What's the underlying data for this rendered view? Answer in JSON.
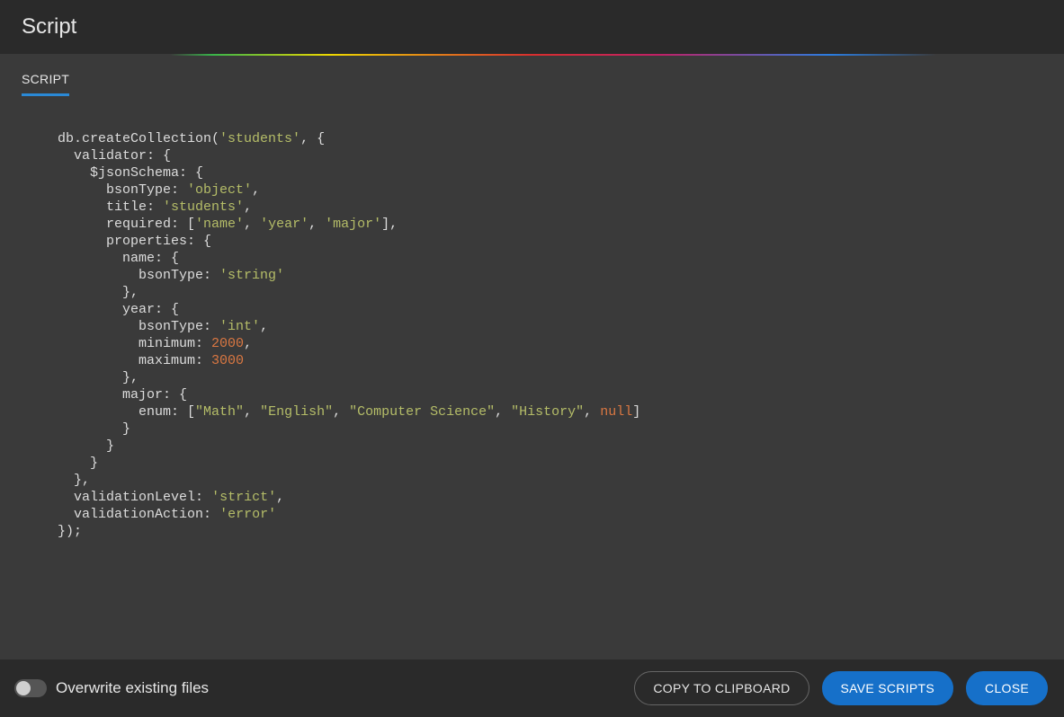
{
  "header": {
    "title": "Script"
  },
  "tabs": {
    "active": "SCRIPT"
  },
  "script": {
    "createCollection_fn": "db.createCollection",
    "collection_name": "'students'",
    "validator_key": "validator",
    "jsonSchema_key": "$jsonSchema",
    "bsonType_key": "bsonType",
    "bsonType_object": "'object'",
    "title_key": "title",
    "title_val": "'students'",
    "required_key": "required",
    "required_items": [
      "'name'",
      "'year'",
      "'major'"
    ],
    "properties_key": "properties",
    "prop_name_key": "name",
    "name_bsonType": "'string'",
    "prop_year_key": "year",
    "year_bsonType": "'int'",
    "minimum_key": "minimum",
    "minimum_val": "2000",
    "maximum_key": "maximum",
    "maximum_val": "3000",
    "prop_major_key": "major",
    "enum_key": "enum",
    "enum_items": [
      "\"Math\"",
      "\"English\"",
      "\"Computer Science\"",
      "\"History\""
    ],
    "enum_null": "null",
    "validationLevel_key": "validationLevel",
    "validationLevel_val": "'strict'",
    "validationAction_key": "validationAction",
    "validationAction_val": "'error'"
  },
  "footer": {
    "toggle_label": "Overwrite existing files",
    "copy_label": "COPY TO CLIPBOARD",
    "save_label": "SAVE SCRIPTS",
    "close_label": "CLOSE"
  }
}
